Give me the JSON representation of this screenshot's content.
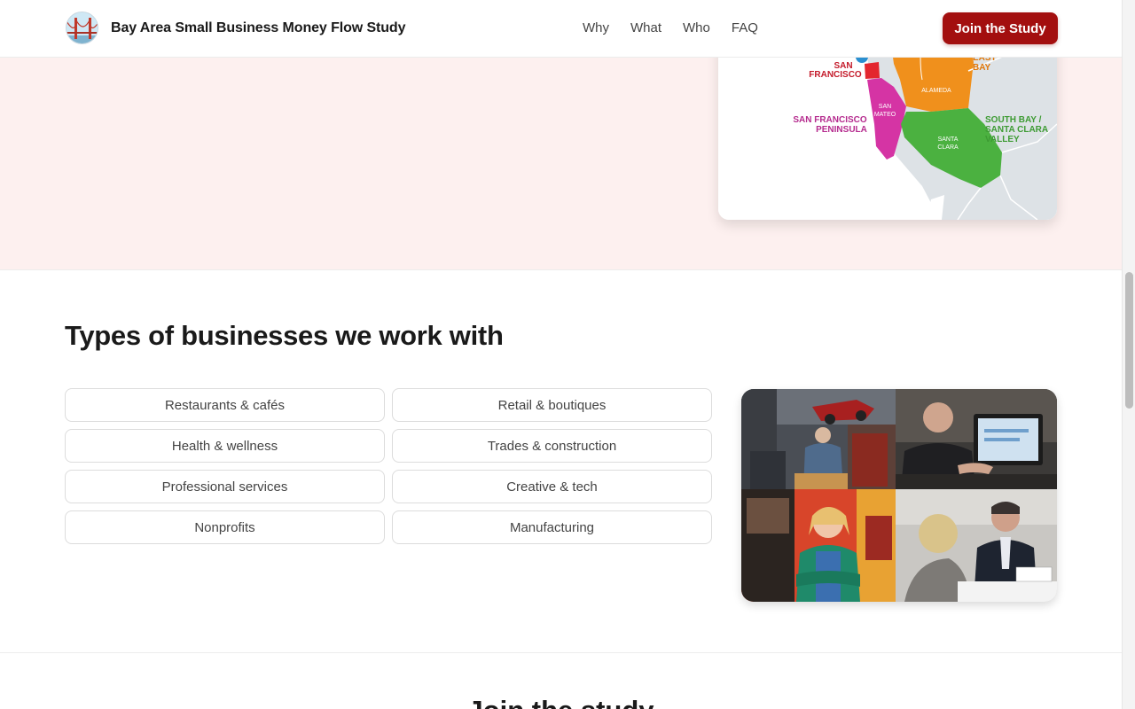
{
  "nav": {
    "brand_title": "Bay Area Small Business Money Flow Study",
    "links": [
      "Why",
      "What",
      "Who",
      "FAQ"
    ],
    "cta": "Join the Study"
  },
  "map": {
    "labels": {
      "san_francisco_1": "SAN",
      "san_francisco_2": "FRANCISCO",
      "east_bay_1": "EAST",
      "east_bay_2": "BAY",
      "alameda": "ALAMEDA",
      "san_mateo_1": "SAN",
      "san_mateo_2": "MATEO",
      "peninsula_1": "SAN FRANCISCO",
      "peninsula_2": "PENINSULA",
      "south_bay_1": "SOUTH BAY /",
      "south_bay_2": "SANTA CLARA",
      "south_bay_3": "VALLEY",
      "santa_clara_1": "SANTA",
      "santa_clara_2": "CLARA"
    },
    "colors": {
      "san_francisco": "#e3262e",
      "east_bay": "#f0901c",
      "peninsula": "#d534a4",
      "south_bay": "#4bb140",
      "water": "#ffffff",
      "land": "#dde2e6"
    }
  },
  "businesses": {
    "title": "Types of businesses we work with",
    "types": [
      "Restaurants & cafés",
      "Retail & boutiques",
      "Health & wellness",
      "Trades & construction",
      "Professional services",
      "Creative & tech",
      "Nonprofits",
      "Manufacturing"
    ]
  },
  "join": {
    "heading": "Join the study"
  }
}
